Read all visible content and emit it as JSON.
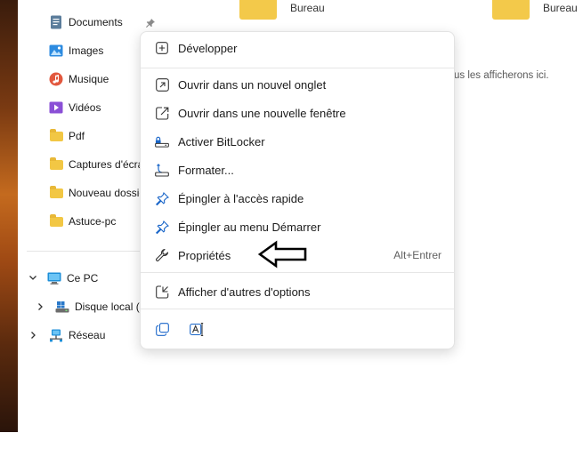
{
  "sidebar": {
    "items": [
      {
        "label": "Documents",
        "icon": "documents-icon"
      },
      {
        "label": "Images",
        "icon": "images-icon"
      },
      {
        "label": "Musique",
        "icon": "music-icon"
      },
      {
        "label": "Vidéos",
        "icon": "videos-icon"
      },
      {
        "label": "Pdf",
        "icon": "folder-icon"
      },
      {
        "label": "Captures d'écra",
        "icon": "folder-icon"
      },
      {
        "label": "Nouveau dossie",
        "icon": "folder-icon"
      },
      {
        "label": "Astuce-pc",
        "icon": "folder-icon"
      }
    ],
    "this_pc": "Ce PC",
    "local_disk": "Disque local (C",
    "network": "Réseau"
  },
  "content": {
    "folder1_caption": "Bureau",
    "folder2_caption": "Bureau",
    "hint": "us les afficherons ici."
  },
  "context_menu": {
    "items": [
      {
        "label": "Développer",
        "icon": "expand-icon"
      },
      {
        "label": "Ouvrir dans un nouvel onglet",
        "icon": "new-tab-icon"
      },
      {
        "label": "Ouvrir dans une nouvelle fenêtre",
        "icon": "new-window-icon"
      },
      {
        "label": "Activer BitLocker",
        "icon": "bitlocker-icon"
      },
      {
        "label": "Formater...",
        "icon": "format-icon"
      },
      {
        "label": "Épingler à l'accès rapide",
        "icon": "pin-icon"
      },
      {
        "label": "Épingler au menu Démarrer",
        "icon": "pin-start-icon"
      },
      {
        "label": "Propriétés",
        "icon": "wrench-icon",
        "shortcut": "Alt+Entrer"
      },
      {
        "label": "Afficher d'autres d'options",
        "icon": "more-options-icon"
      }
    ]
  },
  "colors": {
    "accent": "#1a66c9",
    "folder": "#f2c744"
  }
}
